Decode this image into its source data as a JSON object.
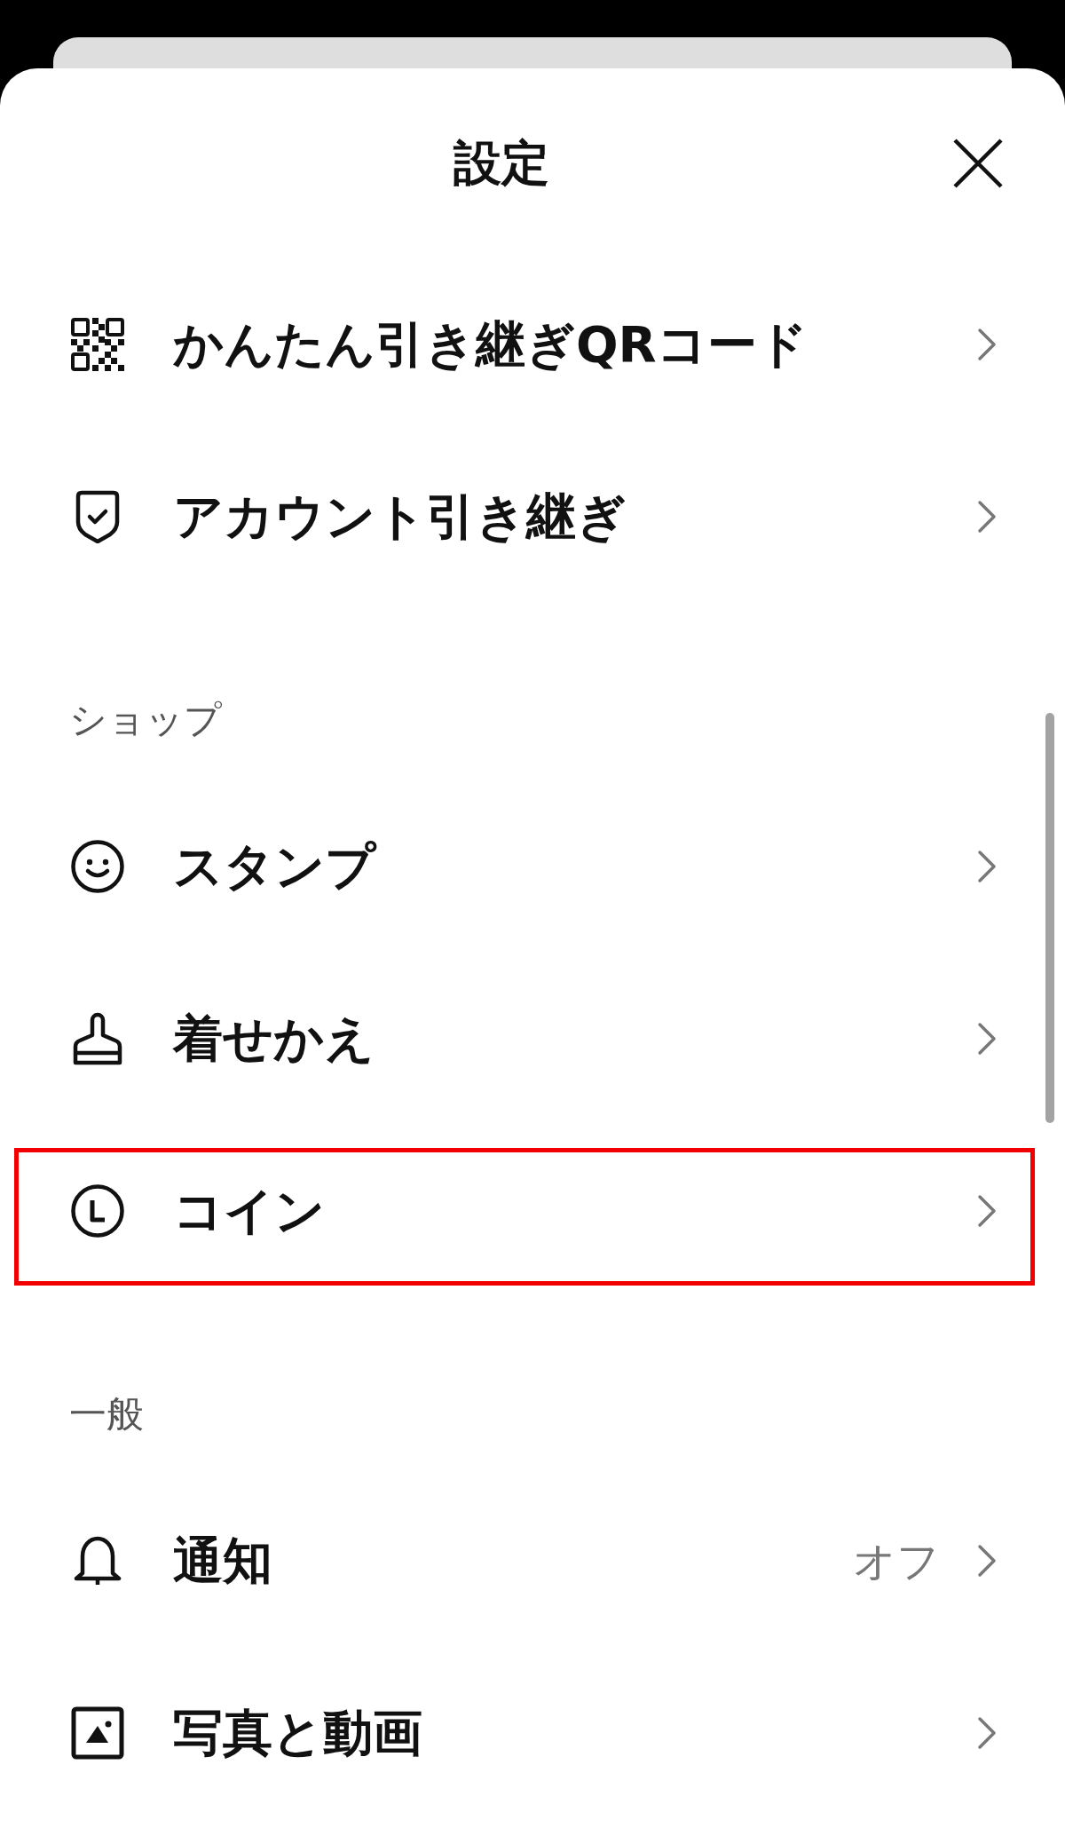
{
  "header": {
    "title": "設定"
  },
  "groups": [
    {
      "items": [
        {
          "label": "かんたん引き継ぎQRコード",
          "highlighted": false
        },
        {
          "label": "アカウント引き継ぎ",
          "highlighted": false
        }
      ]
    },
    {
      "heading": "ショップ",
      "items": [
        {
          "label": "スタンプ",
          "highlighted": false
        },
        {
          "label": "着せかえ",
          "highlighted": false
        },
        {
          "label": "コイン",
          "highlighted": true
        }
      ]
    },
    {
      "heading": "一般",
      "items": [
        {
          "label": "通知",
          "value": "オフ",
          "highlighted": false
        },
        {
          "label": "写真と動画",
          "highlighted": false
        }
      ]
    }
  ]
}
